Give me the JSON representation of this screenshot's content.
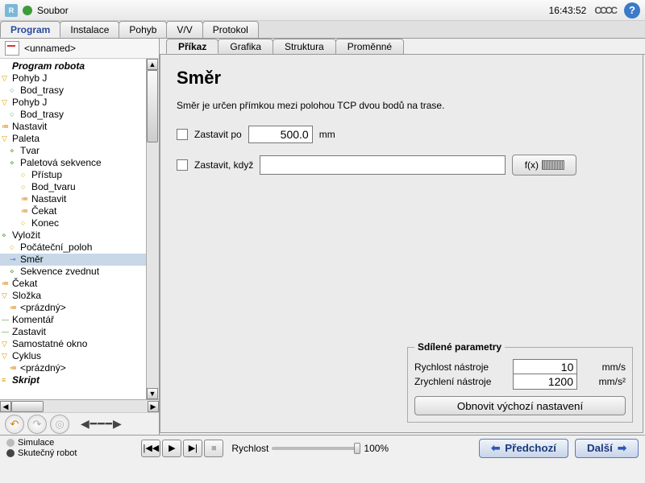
{
  "topbar": {
    "menu_file": "Soubor",
    "time": "16:43:52",
    "signal": "CCCC"
  },
  "main_tabs": [
    "Program",
    "Instalace",
    "Pohyb",
    "V/V",
    "Protokol"
  ],
  "file_name": "<unnamed>",
  "tree": [
    {
      "lvl": 0,
      "cls": "bold",
      "ico": "",
      "txt": "Program robota"
    },
    {
      "lvl": 0,
      "cls": "",
      "ico": "▽",
      "ic": "ico-y",
      "txt": "Pohyb J"
    },
    {
      "lvl": 1,
      "cls": "",
      "ico": "○",
      "ic": "ico-c",
      "txt": "Bod_trasy"
    },
    {
      "lvl": 0,
      "cls": "",
      "ico": "▽",
      "ic": "ico-y",
      "txt": "Pohyb J"
    },
    {
      "lvl": 1,
      "cls": "",
      "ico": "○",
      "ic": "ico-c",
      "txt": "Bod_trasy"
    },
    {
      "lvl": 0,
      "cls": "",
      "ico": "≔",
      "ic": "ico-o",
      "txt": "Nastavit"
    },
    {
      "lvl": 0,
      "cls": "",
      "ico": "▽",
      "ic": "ico-y",
      "txt": "Paleta"
    },
    {
      "lvl": 1,
      "cls": "",
      "ico": "⋄",
      "ic": "ico-g",
      "txt": "Tvar"
    },
    {
      "lvl": 1,
      "cls": "",
      "ico": "⋄",
      "ic": "ico-g",
      "txt": "Paletová sekvence"
    },
    {
      "lvl": 2,
      "cls": "",
      "ico": "○",
      "ic": "ico-y",
      "txt": "Přístup"
    },
    {
      "lvl": 2,
      "cls": "",
      "ico": "○",
      "ic": "ico-y",
      "txt": "Bod_tvaru"
    },
    {
      "lvl": 2,
      "cls": "",
      "ico": "≔",
      "ic": "ico-o",
      "txt": "Nastavit"
    },
    {
      "lvl": 2,
      "cls": "",
      "ico": "≔",
      "ic": "ico-o",
      "txt": "Čekat"
    },
    {
      "lvl": 2,
      "cls": "",
      "ico": "○",
      "ic": "ico-y",
      "txt": "Konec"
    },
    {
      "lvl": 0,
      "cls": "",
      "ico": "⋄",
      "ic": "ico-g",
      "txt": "Vyložit"
    },
    {
      "lvl": 1,
      "cls": "",
      "ico": "○",
      "ic": "ico-y",
      "txt": "Počáteční_poloh"
    },
    {
      "lvl": 1,
      "cls": "sel",
      "ico": "⊸",
      "ic": "ico-b",
      "txt": "Směr"
    },
    {
      "lvl": 1,
      "cls": "",
      "ico": "⋄",
      "ic": "ico-g",
      "txt": "Sekvence zvednut"
    },
    {
      "lvl": 0,
      "cls": "",
      "ico": "≔",
      "ic": "ico-o",
      "txt": "Čekat"
    },
    {
      "lvl": 0,
      "cls": "",
      "ico": "▽",
      "ic": "ico-y",
      "txt": "Složka"
    },
    {
      "lvl": 1,
      "cls": "",
      "ico": "≔",
      "ic": "ico-o",
      "txt": "<prázdný>"
    },
    {
      "lvl": 0,
      "cls": "",
      "ico": "—",
      "ic": "ico-g",
      "txt": "Komentář"
    },
    {
      "lvl": 0,
      "cls": "",
      "ico": "—",
      "ic": "ico-g",
      "txt": "Zastavit"
    },
    {
      "lvl": 0,
      "cls": "",
      "ico": "▽",
      "ic": "ico-y",
      "txt": "Samostatné okno"
    },
    {
      "lvl": 0,
      "cls": "",
      "ico": "▽",
      "ic": "ico-y",
      "txt": "Cyklus"
    },
    {
      "lvl": 1,
      "cls": "",
      "ico": "≔",
      "ic": "ico-o",
      "txt": "<prázdný>"
    },
    {
      "lvl": 0,
      "cls": "bold",
      "ico": "≡",
      "ic": "ico-y",
      "txt": "Skript"
    }
  ],
  "sub_tabs": [
    "Příkaz",
    "Grafika",
    "Struktura",
    "Proměnné"
  ],
  "panel": {
    "title": "Směr",
    "desc": "Směr je určen přímkou mezi polohou TCP dvou bodů na trase.",
    "stop_after_label": "Zastavit po",
    "stop_after_value": "500.0",
    "stop_after_unit": "mm",
    "stop_when_label": "Zastavit, když",
    "stop_when_value": "",
    "fx_label": "f(x)"
  },
  "params": {
    "title": "Sdílené parametry",
    "speed_label": "Rychlost nástroje",
    "speed_value": "10",
    "speed_unit": "mm/s",
    "accel_label": "Zrychlení nástroje",
    "accel_value": "1200",
    "accel_unit": "mm/s²",
    "reset_label": "Obnovit výchozí nastavení"
  },
  "bottom": {
    "sim": "Simulace",
    "real": "Skutečný robot",
    "speed_label": "Rychlost",
    "speed_pct": "100%",
    "prev": "Předchozí",
    "next": "Další"
  }
}
